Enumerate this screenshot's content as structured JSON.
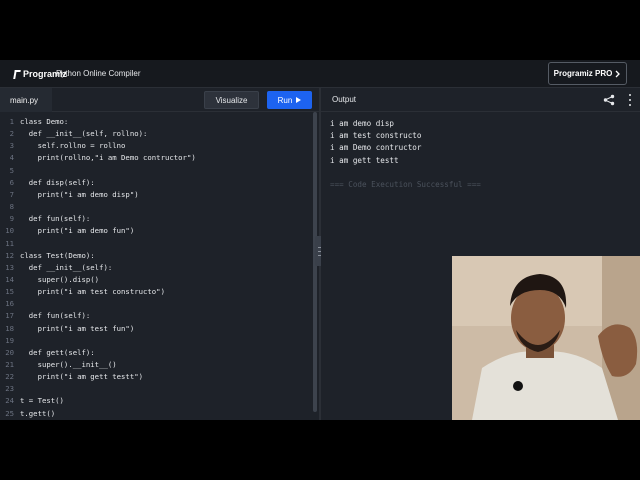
{
  "header": {
    "logo_text": "Programiz",
    "app_title": "Python Online Compiler",
    "pro_button_label": "Programiz PRO"
  },
  "toolbar": {
    "file_tab": "main.py",
    "visualize_label": "Visualize",
    "run_label": "Run",
    "output_label": "Output"
  },
  "editor": {
    "lines": [
      {
        "n": "1",
        "text": "class Demo:"
      },
      {
        "n": "2",
        "text": "  def __init__(self, rollno):"
      },
      {
        "n": "3",
        "text": "    self.rollno = rollno"
      },
      {
        "n": "4",
        "text": "    print(rollno,\"i am Demo contructor\")"
      },
      {
        "n": "5",
        "text": ""
      },
      {
        "n": "6",
        "text": "  def disp(self):"
      },
      {
        "n": "7",
        "text": "    print(\"i am demo disp\")"
      },
      {
        "n": "8",
        "text": ""
      },
      {
        "n": "9",
        "text": "  def fun(self):"
      },
      {
        "n": "10",
        "text": "    print(\"i am demo fun\")"
      },
      {
        "n": "11",
        "text": ""
      },
      {
        "n": "12",
        "text": "class Test(Demo):"
      },
      {
        "n": "13",
        "text": "  def __init__(self):"
      },
      {
        "n": "14",
        "text": "    super().disp()"
      },
      {
        "n": "15",
        "text": "    print(\"i am test constructo\")"
      },
      {
        "n": "16",
        "text": ""
      },
      {
        "n": "17",
        "text": "  def fun(self):"
      },
      {
        "n": "18",
        "text": "    print(\"i am test fun\")"
      },
      {
        "n": "19",
        "text": ""
      },
      {
        "n": "20",
        "text": "  def gett(self):"
      },
      {
        "n": "21",
        "text": "    super().__init__()"
      },
      {
        "n": "22",
        "text": "    print(\"i am gett testt\")"
      },
      {
        "n": "23",
        "text": ""
      },
      {
        "n": "24",
        "text": "t = Test()"
      },
      {
        "n": "25",
        "text": "t.gett()"
      }
    ]
  },
  "output": {
    "lines": [
      "i am demo disp",
      "i am test constructo",
      "i am Demo contructor",
      "i am gett testt"
    ],
    "status": "=== Code Execution Successful ==="
  },
  "icons": {
    "share": "share-icon",
    "more": "more-vertical-icon",
    "run": "play-icon",
    "pro_chevron": "chevron-right-icon"
  },
  "colors": {
    "background": "#1e2229",
    "header": "#16191e",
    "run_button": "#1d63f0",
    "success_text": "#4b525c"
  }
}
